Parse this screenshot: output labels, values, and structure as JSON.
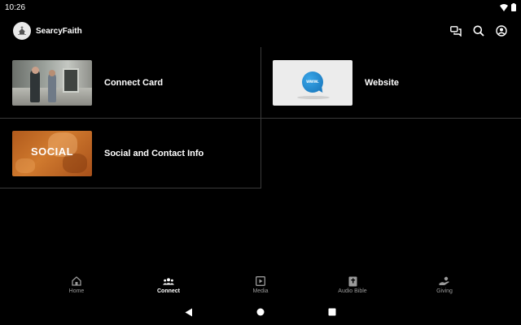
{
  "status": {
    "time": "10:26"
  },
  "app": {
    "name": "SearcyFaith"
  },
  "cards": [
    {
      "label": "Connect Card"
    },
    {
      "label": "Website",
      "thumb_text": "www."
    },
    {
      "label": "Social and Contact Info",
      "thumb_text": "SOCIAL"
    }
  ],
  "nav": [
    {
      "label": "Home",
      "icon": "home-icon"
    },
    {
      "label": "Connect",
      "icon": "people-icon",
      "active": true
    },
    {
      "label": "Media",
      "icon": "play-icon"
    },
    {
      "label": "Audio Bible",
      "icon": "bible-icon"
    },
    {
      "label": "Giving",
      "icon": "giving-hand-icon"
    }
  ],
  "colors": {
    "background": "#000000",
    "text": "#ffffff",
    "inactive_nav": "#9a9a9a",
    "divider": "#3a3a3a"
  }
}
